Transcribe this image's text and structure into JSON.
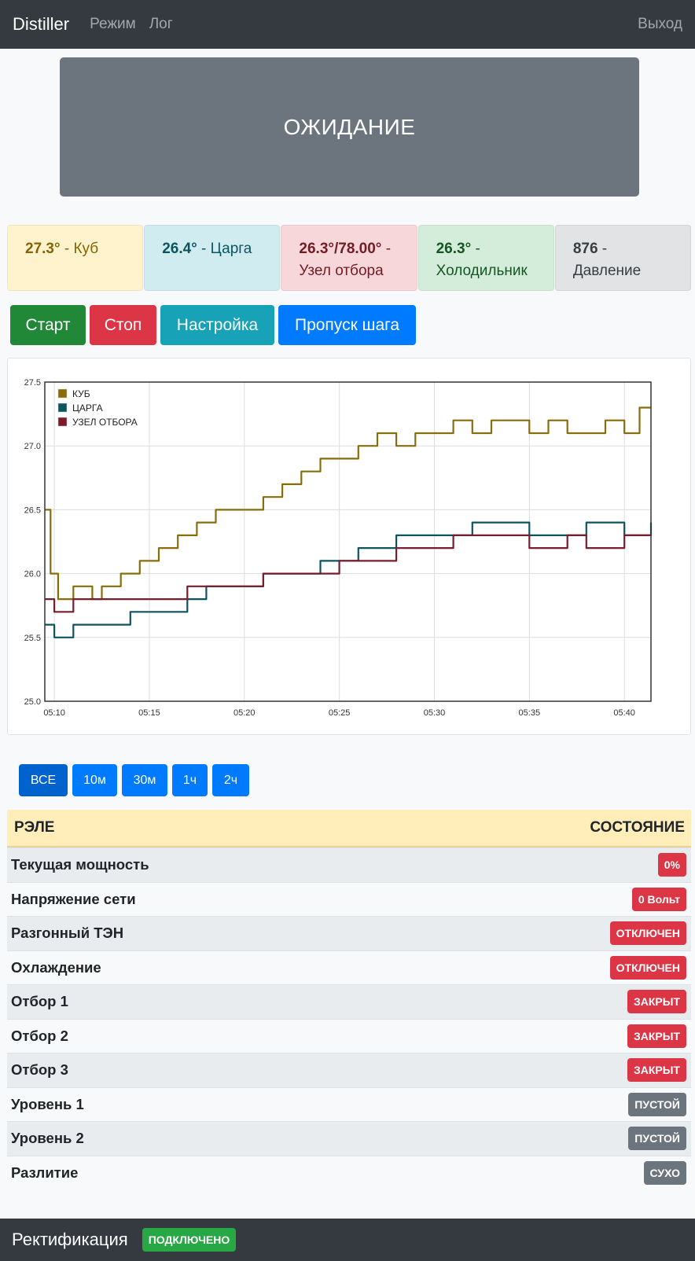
{
  "navbar": {
    "brand": "Distiller",
    "links": [
      "Режим",
      "Лог"
    ],
    "logout": "Выход"
  },
  "status": {
    "text": "ОЖИДАНИЕ",
    "color": "#6c757d"
  },
  "sensors": [
    {
      "value": "27.3°",
      "label": " - Куб"
    },
    {
      "value": "26.4°",
      "label": " - Царга"
    },
    {
      "value": "26.3°/78.00°",
      "label": " - Узел отбора"
    },
    {
      "value": "26.3°",
      "label": " - Холодильник"
    },
    {
      "value": "876",
      "label": " - Давление"
    }
  ],
  "buttons": {
    "start": "Старт",
    "stop": "Стоп",
    "settings": "Настройка",
    "skip": "Пропуск шага"
  },
  "range_buttons": [
    "ВСЕ",
    "10м",
    "30м",
    "1ч",
    "2ч"
  ],
  "relay_table": {
    "header_left": "РЭЛЕ",
    "header_right": "СОСТОЯНИЕ",
    "rows": [
      {
        "name": "Текущая мощность",
        "state": "0%",
        "kind": "danger"
      },
      {
        "name": "Напряжение сети",
        "state": "0 Вольт",
        "kind": "danger"
      },
      {
        "name": "Разгонный ТЭН",
        "state": "ОТКЛЮЧЕН",
        "kind": "danger"
      },
      {
        "name": "Охлаждение",
        "state": "ОТКЛЮЧЕН",
        "kind": "danger"
      },
      {
        "name": "Отбор 1",
        "state": "ЗАКРЫТ",
        "kind": "danger"
      },
      {
        "name": "Отбор 2",
        "state": "ЗАКРЫТ",
        "kind": "danger"
      },
      {
        "name": "Отбор 3",
        "state": "ЗАКРЫТ",
        "kind": "danger"
      },
      {
        "name": "Уровень 1",
        "state": "ПУСТОЙ",
        "kind": "secondary"
      },
      {
        "name": "Уровень 2",
        "state": "ПУСТОЙ",
        "kind": "secondary"
      },
      {
        "name": "Разлитие",
        "state": "СУХО",
        "kind": "secondary"
      }
    ]
  },
  "footer": {
    "title": "Ректификация",
    "badge": "ПОДКЛЮЧЕНО"
  },
  "chart_data": {
    "type": "line",
    "x_ticks": [
      "05:10",
      "05:15",
      "05:20",
      "05:25",
      "05:30",
      "05:35",
      "05:40"
    ],
    "y_ticks": [
      "25.0",
      "25.5",
      "26.0",
      "26.5",
      "27.0",
      "27.5"
    ],
    "ylim": [
      25.0,
      27.5
    ],
    "xlim": [
      "05:09.5",
      "05:41.4"
    ],
    "legend_position": "top-left",
    "grid": true,
    "series": [
      {
        "name": "КУБ",
        "color": "#8a6d0b",
        "points": [
          [
            "05:09.5",
            26.5
          ],
          [
            "05:09.8",
            26.0
          ],
          [
            "05:10.2",
            25.8
          ],
          [
            "05:11",
            25.9
          ],
          [
            "05:12",
            25.8
          ],
          [
            "05:12.5",
            25.9
          ],
          [
            "05:13.5",
            26.0
          ],
          [
            "05:14.5",
            26.1
          ],
          [
            "05:15.5",
            26.2
          ],
          [
            "05:16.5",
            26.3
          ],
          [
            "05:17.5",
            26.4
          ],
          [
            "05:18.5",
            26.5
          ],
          [
            "05:20",
            26.5
          ],
          [
            "05:21",
            26.6
          ],
          [
            "05:22",
            26.7
          ],
          [
            "05:23",
            26.8
          ],
          [
            "05:24",
            26.9
          ],
          [
            "05:25",
            26.9
          ],
          [
            "05:26",
            27.0
          ],
          [
            "05:27",
            27.1
          ],
          [
            "05:28",
            27.0
          ],
          [
            "05:29",
            27.1
          ],
          [
            "05:30",
            27.1
          ],
          [
            "05:31",
            27.2
          ],
          [
            "05:32",
            27.1
          ],
          [
            "05:33",
            27.2
          ],
          [
            "05:34",
            27.2
          ],
          [
            "05:35",
            27.1
          ],
          [
            "05:36",
            27.2
          ],
          [
            "05:37",
            27.1
          ],
          [
            "05:38",
            27.1
          ],
          [
            "05:39",
            27.2
          ],
          [
            "05:40",
            27.1
          ],
          [
            "05:40.8",
            27.3
          ],
          [
            "05:41.4",
            27.3
          ]
        ]
      },
      {
        "name": "ЦАРГА",
        "color": "#0c5460",
        "points": [
          [
            "05:09.5",
            25.6
          ],
          [
            "05:10",
            25.5
          ],
          [
            "05:11",
            25.6
          ],
          [
            "05:13",
            25.6
          ],
          [
            "05:14",
            25.7
          ],
          [
            "05:16",
            25.7
          ],
          [
            "05:17",
            25.8
          ],
          [
            "05:18",
            25.9
          ],
          [
            "05:20",
            25.9
          ],
          [
            "05:21",
            26.0
          ],
          [
            "05:22",
            26.0
          ],
          [
            "05:23",
            26.0
          ],
          [
            "05:24",
            26.1
          ],
          [
            "05:25",
            26.1
          ],
          [
            "05:26",
            26.2
          ],
          [
            "05:27",
            26.2
          ],
          [
            "05:28",
            26.3
          ],
          [
            "05:30",
            26.3
          ],
          [
            "05:31",
            26.3
          ],
          [
            "05:32",
            26.4
          ],
          [
            "05:34",
            26.4
          ],
          [
            "05:35",
            26.3
          ],
          [
            "05:37",
            26.3
          ],
          [
            "05:38",
            26.4
          ],
          [
            "05:40",
            26.3
          ],
          [
            "05:41.4",
            26.4
          ]
        ]
      },
      {
        "name": "УЗЕЛ ОТБОРА",
        "color": "#7b1c2b",
        "points": [
          [
            "05:09.5",
            25.8
          ],
          [
            "05:10",
            25.7
          ],
          [
            "05:11",
            25.8
          ],
          [
            "05:13",
            25.8
          ],
          [
            "05:15",
            25.8
          ],
          [
            "05:16",
            25.8
          ],
          [
            "05:17",
            25.9
          ],
          [
            "05:19",
            25.9
          ],
          [
            "05:20",
            25.9
          ],
          [
            "05:21",
            26.0
          ],
          [
            "05:22",
            26.0
          ],
          [
            "05:24",
            26.0
          ],
          [
            "05:25",
            26.1
          ],
          [
            "05:27",
            26.1
          ],
          [
            "05:28",
            26.2
          ],
          [
            "05:30",
            26.2
          ],
          [
            "05:31",
            26.3
          ],
          [
            "05:33",
            26.3
          ],
          [
            "05:34",
            26.3
          ],
          [
            "05:35",
            26.2
          ],
          [
            "05:37",
            26.3
          ],
          [
            "05:38",
            26.2
          ],
          [
            "05:40",
            26.3
          ],
          [
            "05:41.4",
            26.3
          ]
        ]
      }
    ]
  }
}
